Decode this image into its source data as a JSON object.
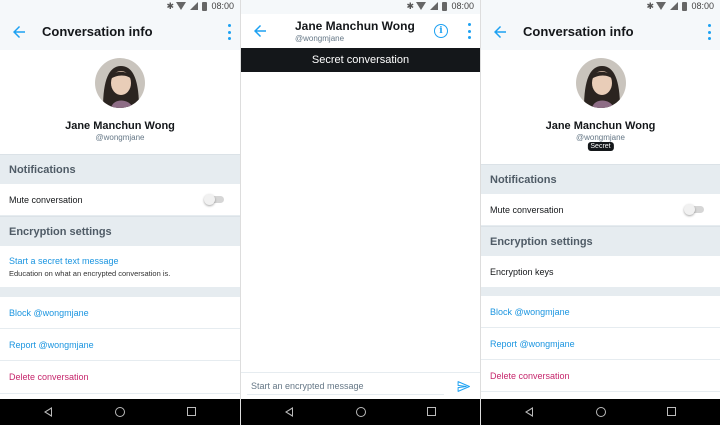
{
  "status": {
    "time": "08:00"
  },
  "colors": {
    "accent": "#1da1f2",
    "danger": "#c6266c",
    "section_bg": "#e6ecf0"
  },
  "icons": [
    "arrow-left-icon",
    "more-vert-icon",
    "info-icon",
    "send-icon",
    "bluetooth-icon",
    "wifi-icon",
    "signal-icon",
    "battery-icon",
    "nav-back-icon",
    "nav-home-icon",
    "nav-recents-icon"
  ],
  "left_panel": {
    "title": "Conversation info",
    "profile": {
      "name": "Jane Manchun Wong",
      "handle": "@wongmjane"
    },
    "notifications_header": "Notifications",
    "mute_label": "Mute conversation",
    "mute_on": false,
    "encryption_header": "Encryption settings",
    "secret_msg_label": "Start a secret text message",
    "secret_msg_sub": "Education on what an encrypted conversation is.",
    "block_label": "Block @wongmjane",
    "report_label": "Report @wongmjane",
    "delete_label": "Delete conversation"
  },
  "middle_panel": {
    "name": "Jane Manchun Wong",
    "handle": "@wongmjane",
    "banner": "Secret conversation",
    "composer_placeholder": "Start an encrypted message"
  },
  "right_panel": {
    "title": "Conversation info",
    "profile": {
      "name": "Jane Manchun Wong",
      "handle": "@wongmjane",
      "badge": "Secret"
    },
    "notifications_header": "Notifications",
    "mute_label": "Mute conversation",
    "mute_on": false,
    "encryption_header": "Encryption settings",
    "encryption_keys_label": "Encryption keys",
    "block_label": "Block @wongmjane",
    "report_label": "Report @wongmjane",
    "delete_label": "Delete conversation"
  }
}
